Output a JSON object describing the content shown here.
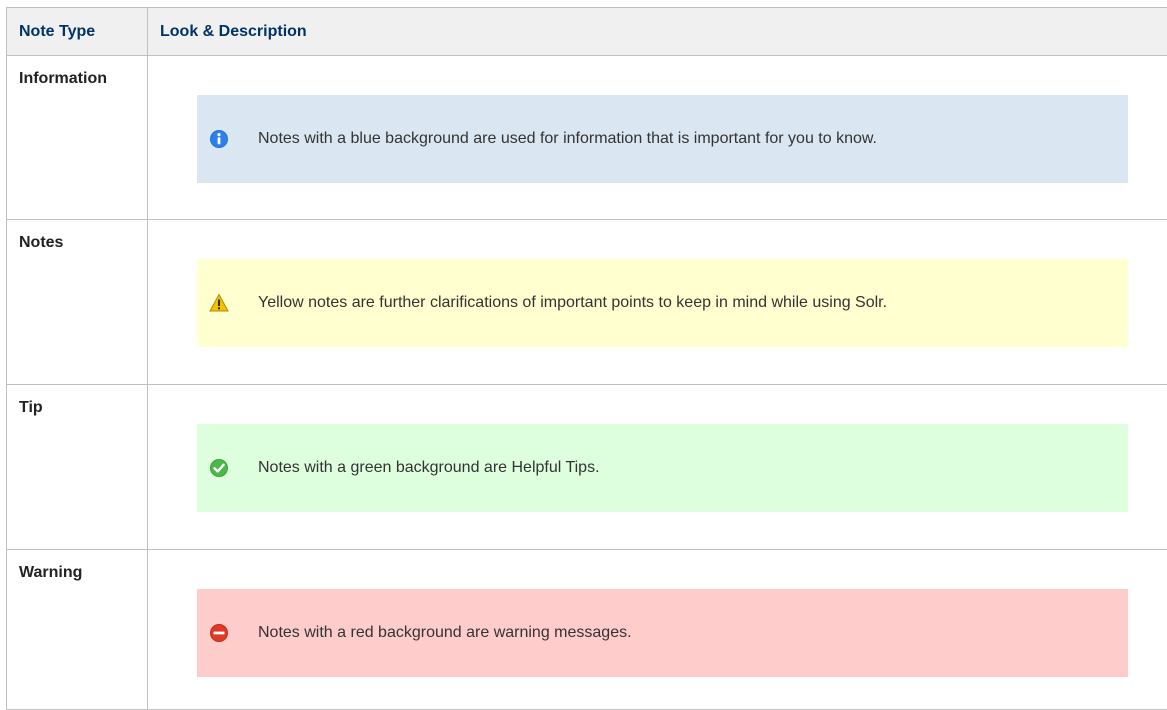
{
  "header": {
    "col1": "Note Type",
    "col2": "Look & Description"
  },
  "rows": [
    {
      "type": "Information",
      "text": "Notes with a blue background are used for information that is important for you to know.",
      "icon": "info-icon",
      "color": "#dae6f2"
    },
    {
      "type": "Notes",
      "text": "Yellow notes are further clarifications of important points to keep in mind while using Solr.",
      "icon": "warning-icon",
      "color": "#ffffcf"
    },
    {
      "type": "Tip",
      "text": "Notes with a green background are Helpful Tips.",
      "icon": "check-icon",
      "color": "#ddffdd"
    },
    {
      "type": "Warning",
      "text": "Notes with a red background are warning messages.",
      "icon": "forbidden-icon",
      "color": "#ffcccc"
    }
  ]
}
